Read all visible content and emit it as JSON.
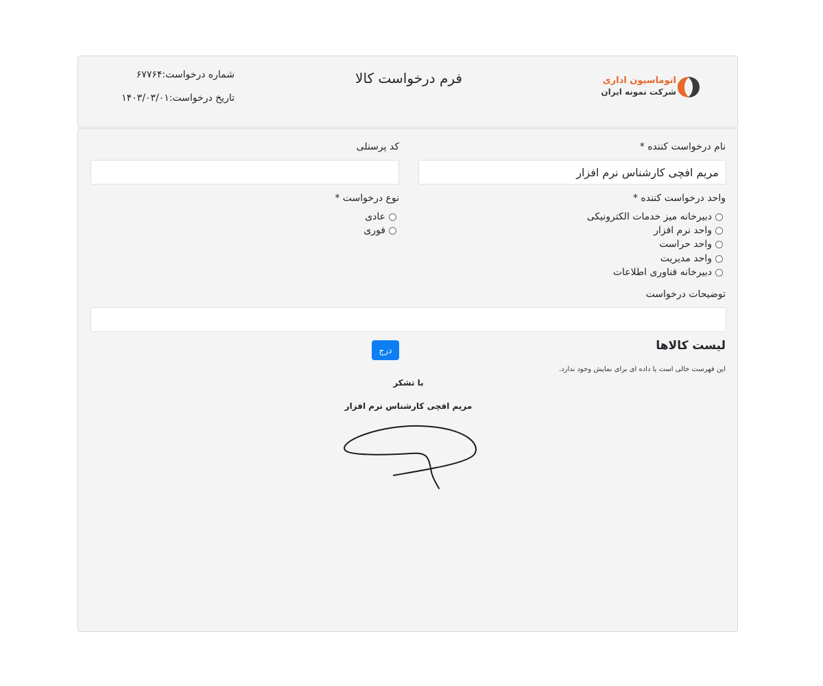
{
  "header": {
    "logo": {
      "line1": "اتوماسیون اداری",
      "line2": "شرکت نمونه ایران",
      "accent_color": "#e8692a"
    },
    "title": "فرم درخواست کالا",
    "request_number": "شماره درخواست:۶۷۷۶۴",
    "request_date": "تاریخ درخواست:۱۴۰۳/۰۳/۰۱"
  },
  "form": {
    "requester_name": {
      "label": "نام درخواست کننده *",
      "value": "مریم افچی کارشناس نرم افزار"
    },
    "personnel_code": {
      "label": "کد پرسنلی",
      "value": ""
    },
    "requesting_unit": {
      "label": "واحد درخواست کننده *",
      "options": [
        "دبیرخانه میز خدمات الکترونیکی",
        "واحد نرم افزار",
        "واحد حراست",
        "واحد مدیریت",
        "دبیرخانه فناوری اطلاعات"
      ]
    },
    "request_type": {
      "label": "نوع درخواست *",
      "options": [
        "عادی",
        "فوری"
      ]
    },
    "description": {
      "label": "توضیحات درخواست",
      "value": ""
    }
  },
  "goods_list": {
    "title": "لیست کالاها",
    "empty_message": "این فهرست خالی است یا داده ای برای نمایش وجود ندارد.",
    "insert_button": "درج",
    "button_color": "#0d7ff2"
  },
  "closing": {
    "thanks": "با تشکر",
    "signer": "مریم افچی کارشناس نرم افزار"
  }
}
